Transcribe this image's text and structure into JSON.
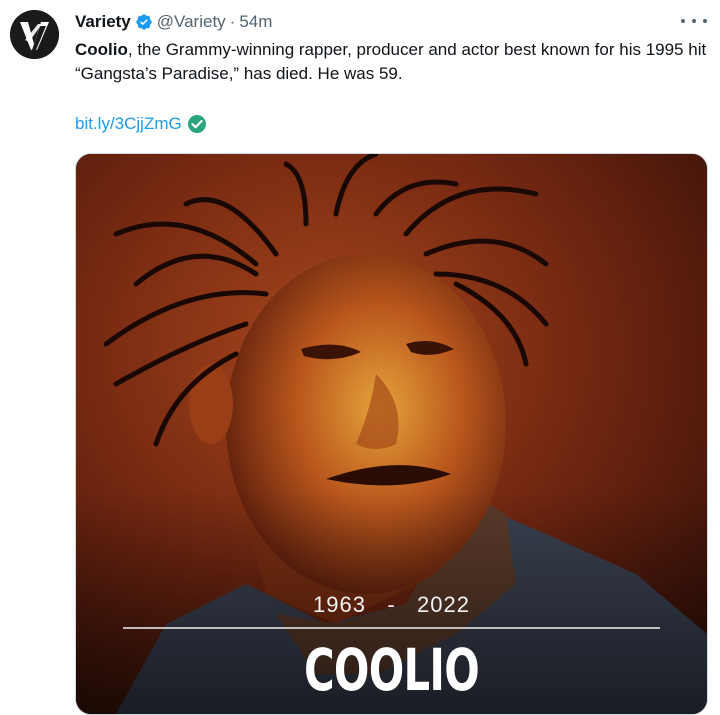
{
  "tweet": {
    "author_name": "Variety",
    "handle": "@Variety",
    "separator": "·",
    "time": "54m",
    "text_bold": "Coolio",
    "text_rest": ", the Grammy-winning rapper, producer and actor best known for his 1995 hit “Gangsta’s Paradise,” has died. He was 59.",
    "link": "bit.ly/3CjjZmG"
  },
  "media": {
    "years_start": "1963",
    "years_sep": "-",
    "years_end": "2022",
    "headline": "COOLIO"
  },
  "icons": {
    "avatar": "variety-v-logo",
    "verified": "verified-badge-icon",
    "link_check": "check-circle-icon",
    "more": "more-dots-icon"
  },
  "colors": {
    "link": "#1d9bf0",
    "secondary_text": "#536471",
    "verified": "#1d9bf0",
    "check": "#2ba57a"
  }
}
